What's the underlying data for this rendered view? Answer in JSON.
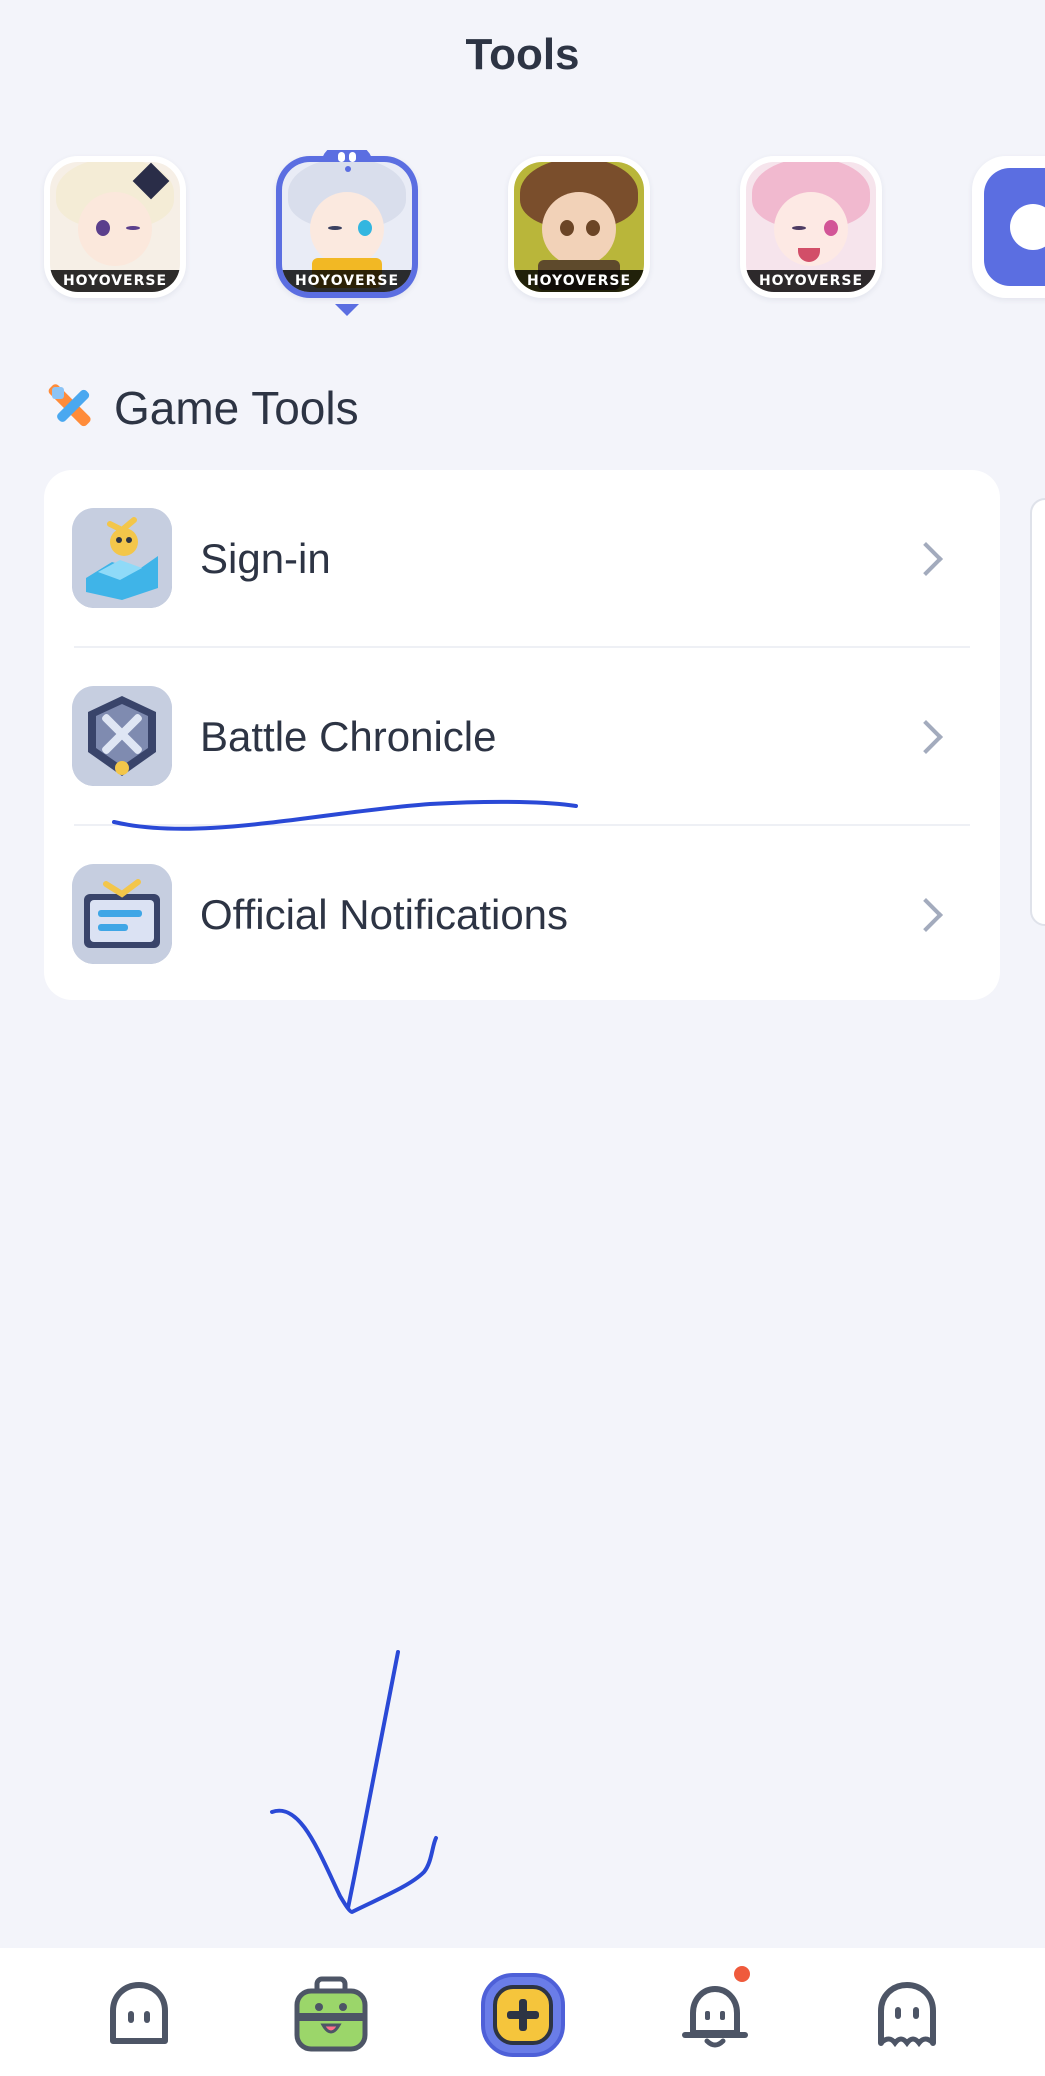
{
  "header": {
    "title": "Tools"
  },
  "games": [
    {
      "name": "game-1",
      "brand": "HOYOVERSE",
      "active": false
    },
    {
      "name": "game-2",
      "brand": "HOYOVERSE",
      "active": true
    },
    {
      "name": "game-3",
      "brand": "HOYOVERSE",
      "active": false
    },
    {
      "name": "game-4",
      "brand": "HOYOVERSE",
      "active": false
    }
  ],
  "section": {
    "title": "Game Tools",
    "icon": "tools-icon"
  },
  "tools": [
    {
      "label": "Sign-in",
      "icon": "sign-in-icon"
    },
    {
      "label": "Battle Chronicle",
      "icon": "battle-chronicle-icon"
    },
    {
      "label": "Official Notifications",
      "icon": "notifications-icon"
    }
  ],
  "nav": [
    {
      "name": "home",
      "icon": "home-icon"
    },
    {
      "name": "tools",
      "icon": "toolbox-icon",
      "active": true
    },
    {
      "name": "post",
      "icon": "add-post-icon"
    },
    {
      "name": "notifications",
      "icon": "bell-icon",
      "badge": true
    },
    {
      "name": "profile",
      "icon": "profile-icon"
    }
  ],
  "colors": {
    "background": "#f3f4fa",
    "accent": "#5b6ee1",
    "text": "#2d3444",
    "badge": "#ef5a3c",
    "annotation": "#2a49d6"
  }
}
